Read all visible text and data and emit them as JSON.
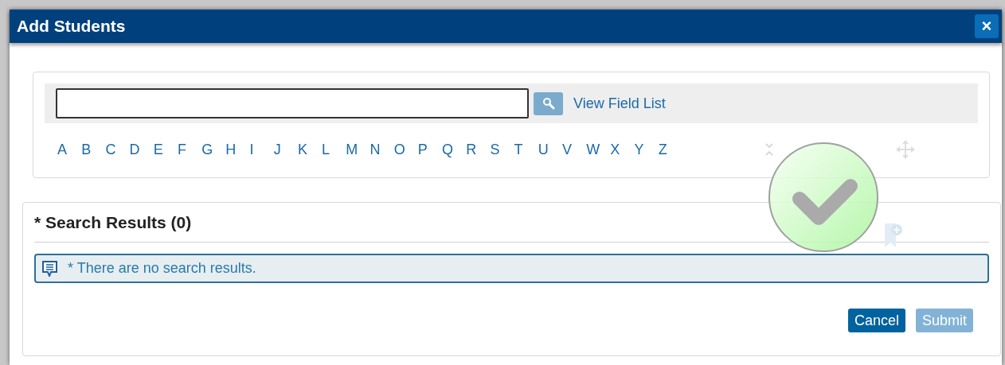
{
  "dialog": {
    "title": "Add Students",
    "close_label": "×"
  },
  "search": {
    "link": "View Field List"
  },
  "letters": [
    "A",
    "B",
    "C",
    "D",
    "E",
    "F",
    "G",
    "H",
    "I",
    "J",
    "K",
    "L",
    "M",
    "N",
    "O",
    "P",
    "Q",
    "R",
    "S",
    "T",
    "U",
    "V",
    "W",
    "X",
    "Y",
    "Z"
  ],
  "results": {
    "title": "* Search Results (0)",
    "message": "* There are no search results."
  },
  "buttons": [
    {
      "label": "Cancel",
      "disabled": false
    },
    {
      "label": "Submit",
      "disabled": true
    }
  ]
}
